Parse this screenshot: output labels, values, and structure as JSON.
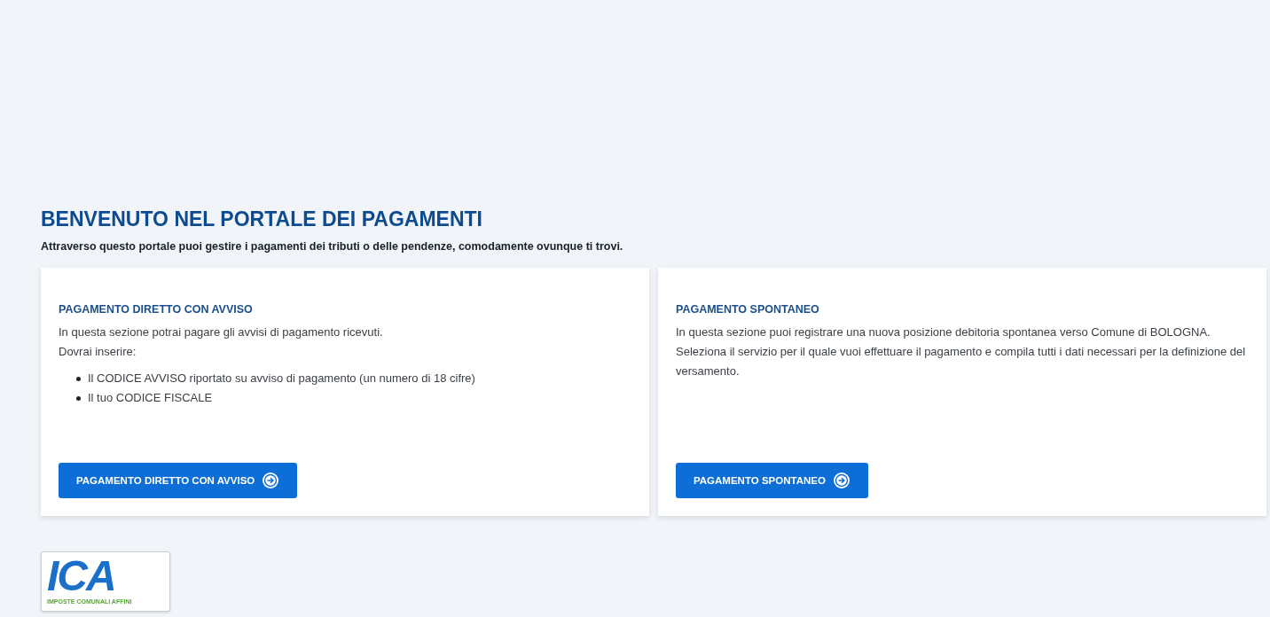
{
  "header": {
    "title": "BENVENUTO NEL PORTALE DEI PAGAMENTI",
    "subtitle": "Attraverso questo portale puoi gestire i pagamenti dei tributi o delle pendenze, comodamente ovunque ti trovi."
  },
  "cards": [
    {
      "title": "PAGAMENTO DIRETTO CON AVVISO",
      "paragraphs": [
        "In questa sezione potrai pagare gli avvisi di pagamento ricevuti.",
        "Dovrai inserire:"
      ],
      "bullets": [
        "Il CODICE AVVISO riportato su avviso di pagamento (un numero di 18 cifre)",
        "Il tuo CODICE FISCALE"
      ],
      "button": "PAGAMENTO DIRETTO CON AVVISO"
    },
    {
      "title": "PAGAMENTO SPONTANEO",
      "paragraphs": [
        "In questa sezione puoi registrare una nuova posizione debitoria spontanea verso Comune di BOLOGNA. Seleziona il servizio per il quale vuoi effettuare il pagamento e compila tutti i dati necessari per la definizione del versamento."
      ],
      "button": "PAGAMENTO SPONTANEO"
    }
  ],
  "logo": {
    "mark": "ICA",
    "tagline": "IMPOSTE COMUNALI AFFINI"
  }
}
